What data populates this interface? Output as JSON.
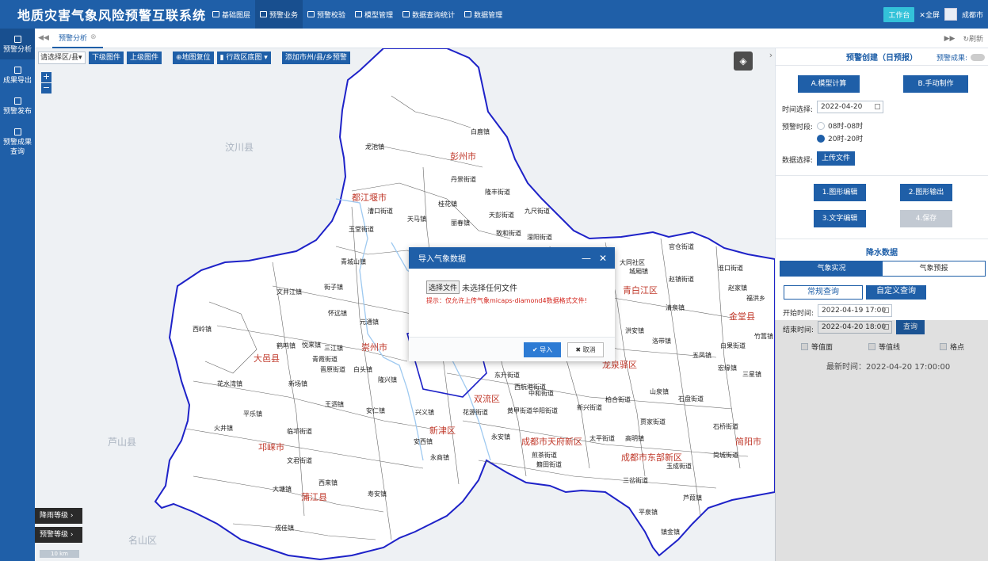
{
  "header": {
    "title": "地质灾害气象风险预警互联系统",
    "nav": [
      "基础图层",
      "预警业务",
      "预警校验",
      "模型管理",
      "数据查询统计",
      "数据管理"
    ],
    "workbench": "工作台",
    "fullscreen": "全屏",
    "city": "成都市"
  },
  "sidebar": {
    "items": [
      "预警分析",
      "成果导出",
      "预警发布",
      "预警成果查询"
    ]
  },
  "tabbar": {
    "tab": "预警分析",
    "refresh": "刷新"
  },
  "map": {
    "toolbar": {
      "select": "请选择区/县",
      "down": "下级图件",
      "up": "上级图件",
      "reset": "地图复位",
      "district": "行政区底图",
      "add": "添加市州/县/乡预警"
    },
    "zoom_in": "+",
    "zoom_out": "−",
    "legend_rain": "降雨等级",
    "legend_warn": "预警等级",
    "scale": "10 km",
    "cities": [
      "彭州市",
      "都江堰市",
      "崇州市",
      "大邑县",
      "邛崃市",
      "蒲江县",
      "双流区",
      "新津区",
      "成都市天府新区",
      "成都市东部新区",
      "青白江区",
      "金堂县",
      "龙泉驿区",
      "简阳市"
    ],
    "towns": [
      "龙池镇",
      "白鹿镇",
      "丹景街道",
      "隆丰街道",
      "天彭街道",
      "九尺街道",
      "漕口街道",
      "天马镇",
      "桂花镇",
      "丽春镇",
      "致和街道",
      "濛阳街道",
      "玉堂街道",
      "青城山镇",
      "街子镇",
      "文井江镇",
      "怀远镇",
      "元通镇",
      "西岭镇",
      "鹤鸣镇",
      "悦来镇",
      "三江镇",
      "青霞街道",
      "晋原街道",
      "白头镇",
      "隆兴镇",
      "花水湾镇",
      "新场镇",
      "王泗镇",
      "安仁镇",
      "平乐镇",
      "火井镇",
      "临邛街道",
      "文君街道",
      "西来镇",
      "大塘镇",
      "寿安镇",
      "成佳镇",
      "安西镇",
      "永商镇",
      "永安镇",
      "煎茶街道",
      "籍田街道",
      "官仓街道",
      "大同社区",
      "城厢镇",
      "赵镇街道",
      "清泉镇",
      "洪安镇",
      "洛带镇",
      "五凤镇",
      "白果街道",
      "宏缘镇",
      "三星镇",
      "山泉镇",
      "石盘街道",
      "贾家街道",
      "高明镇",
      "玉成街道",
      "石桥街道",
      "简城街道",
      "三岔街道",
      "芦葭镇",
      "镇金镇",
      "东升街道",
      "西航港街道",
      "中和街道",
      "华阳街道",
      "兴义镇",
      "花源街道",
      "黄甲街道",
      "新兴街道",
      "柏合街道",
      "太平街道",
      "赵家镇",
      "福洪乡",
      "竹篙镇",
      "淮口街道",
      "平泉镇"
    ],
    "ghost_labels": [
      "汶川县",
      "芦山县",
      "名山区"
    ]
  },
  "panel": {
    "title": "预警创建（日预报）",
    "result_label": "预警成果:",
    "model_btn": "A.模型计算",
    "manual_btn": "B.手动制作",
    "time_label": "时间选择:",
    "date": "2022-04-20",
    "period_label": "预警时段:",
    "period_opt1": "08时-08时",
    "period_opt2": "20时-20时",
    "data_label": "数据选择:",
    "upload_btn": "上传文件",
    "btn_edit_graph": "1.图形编辑",
    "btn_output_graph": "2.图形输出",
    "btn_edit_text": "3.文字编辑",
    "btn_save": "4.保存",
    "rain_title": "降水数据",
    "tab_actual": "气象实况",
    "tab_forecast": "气象预报",
    "query_normal": "常规查询",
    "query_custom": "自定义查询",
    "start_label": "开始时间:",
    "start_time": "2022-04-19 17:00",
    "end_label": "结束时间:",
    "end_time": "2022-04-20 18:00",
    "query_btn": "查询",
    "cb_area": "等值面",
    "cb_line": "等值线",
    "cb_point": "格点",
    "latest": "最新时间：2022-04-20 17:00:00"
  },
  "dialog": {
    "title": "导入气象数据",
    "choose_btn": "选择文件",
    "no_file": "未选择任何文件",
    "hint": "提示：仅允许上传气象micaps-diamond4数据格式文件!",
    "ok": "导入",
    "cancel": "取消"
  },
  "colors": {
    "primary": "#1f5fa8",
    "boundary": "#1e22c8",
    "river": "#9ec9f0",
    "hint": "#d3241c"
  }
}
